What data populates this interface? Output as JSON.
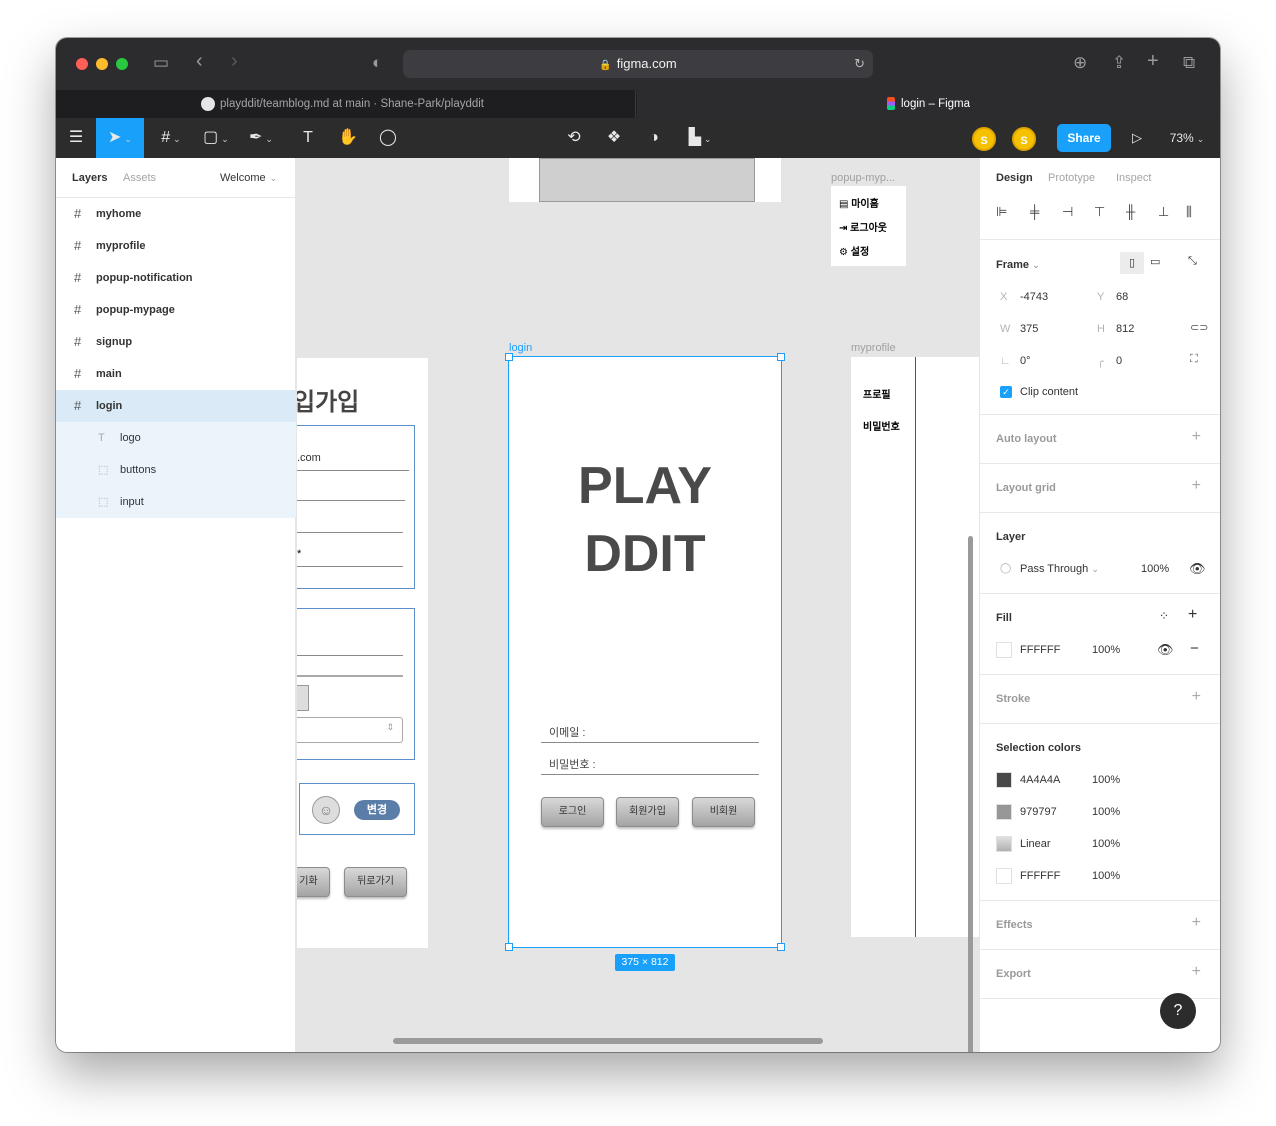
{
  "browser": {
    "url": "figma.com",
    "tabs": [
      {
        "label": "playddit/teamblog.md at main · Shane-Park/playddit"
      },
      {
        "label": "login – Figma"
      }
    ]
  },
  "toolbar": {
    "share_label": "Share",
    "zoom": "73%",
    "avatar_initial": "S",
    "avatar_initial_2": "S"
  },
  "left_panel": {
    "tab_layers": "Layers",
    "tab_assets": "Assets",
    "page": "Welcome",
    "layers": [
      {
        "name": "myhome"
      },
      {
        "name": "myprofile"
      },
      {
        "name": "popup-notification"
      },
      {
        "name": "popup-mypage"
      },
      {
        "name": "signup"
      },
      {
        "name": "main"
      },
      {
        "name": "login"
      },
      {
        "name": "logo"
      },
      {
        "name": "buttons"
      },
      {
        "name": "input"
      }
    ]
  },
  "canvas": {
    "popup_label": "popup-myp...",
    "popup_items": [
      "마이홈",
      "로그아웃",
      "설정"
    ],
    "login_label": "login",
    "logo_line1": "PLAY",
    "logo_line2": "DDIT",
    "email_label": "이메일 :",
    "password_label": "비밀번호 :",
    "btn_login": "로그인",
    "btn_signup": "회원가입",
    "btn_guest": "비회원",
    "size_badge": "375 × 812",
    "myprofile_label": "myprofile",
    "profile_items": [
      "프로필",
      "비밀번호"
    ],
    "signup_title_partial": "입가입",
    "signup_email_partial": ".com",
    "signup_asterisk": "*",
    "signup_change": "변경",
    "signup_btn_partial": "기화",
    "signup_back": "뒤로가기"
  },
  "right_panel": {
    "tabs": [
      "Design",
      "Prototype",
      "Inspect"
    ],
    "frame_title": "Frame",
    "x_label": "X",
    "x": "-4743",
    "y_label": "Y",
    "y": "68",
    "w_label": "W",
    "w": "375",
    "h_label": "H",
    "h": "812",
    "rotation": "0°",
    "radius": "0",
    "clip_content": "Clip content",
    "auto_layout": "Auto layout",
    "layout_grid": "Layout grid",
    "layer_title": "Layer",
    "blend": "Pass Through",
    "layer_opacity": "100%",
    "fill_title": "Fill",
    "fill_hex": "FFFFFF",
    "fill_opacity": "100%",
    "stroke_title": "Stroke",
    "selection_colors_title": "Selection colors",
    "selection_colors": [
      {
        "name": "4A4A4A",
        "opacity": "100%",
        "color": "#4A4A4A"
      },
      {
        "name": "979797",
        "opacity": "100%",
        "color": "#979797"
      },
      {
        "name": "Linear",
        "opacity": "100%",
        "color": "#c8c8c8"
      },
      {
        "name": "FFFFFF",
        "opacity": "100%",
        "color": "#FFFFFF"
      }
    ],
    "effects": "Effects",
    "export": "Export",
    "help": "?"
  }
}
